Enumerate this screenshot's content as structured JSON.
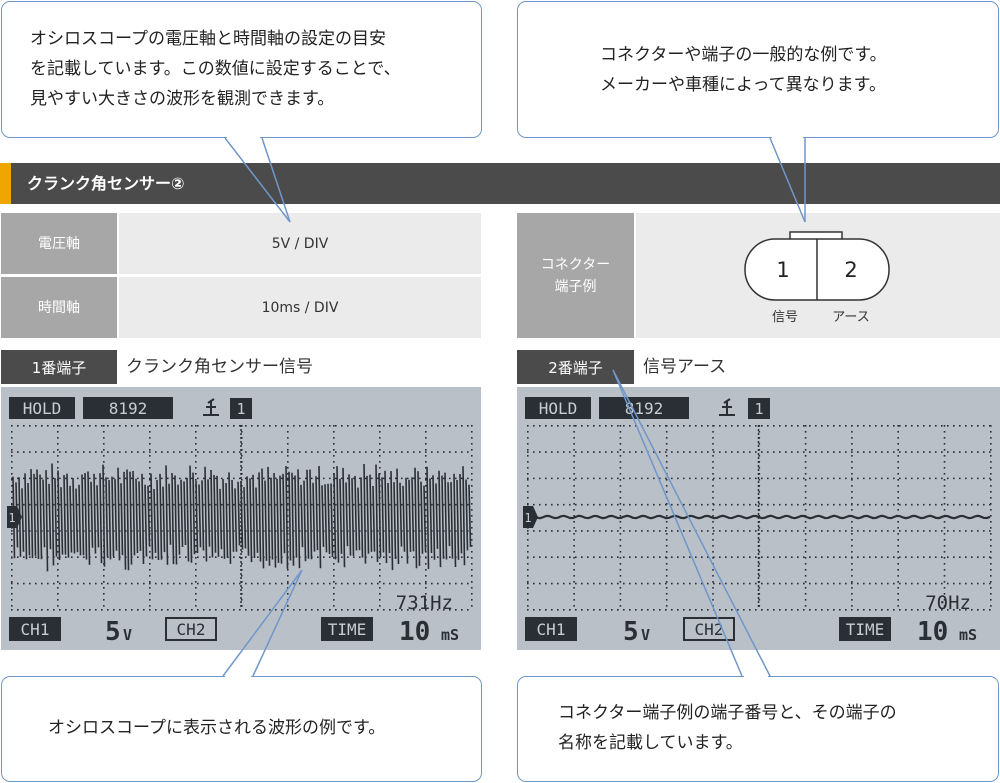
{
  "callouts": {
    "top_left": [
      "オシロスコープの電圧軸と時間軸の設定の目安",
      "を記載しています。この数値に設定することで、",
      "見やすい大きさの波形を観測できます。"
    ],
    "top_right": [
      "コネクターや端子の一般的な例です。",
      "メーカーや車種によって異なります。"
    ],
    "bottom_left": [
      "オシロスコープに表示される波形の例です。"
    ],
    "bottom_right": [
      "コネクター端子例の端子番号と、その端子の",
      "名称を記載しています。"
    ]
  },
  "section": {
    "title": "クランク角センサー②"
  },
  "settings": {
    "voltage_label": "電圧軸",
    "voltage_value": "5V / DIV",
    "time_label": "時間軸",
    "time_value": "10ms / DIV"
  },
  "connector": {
    "label_line1": "コネクター",
    "label_line2": "端子例",
    "pin1_number": "1",
    "pin2_number": "2",
    "pin1_name": "信号",
    "pin2_name": "アース"
  },
  "pins": [
    {
      "label": "1番端子",
      "desc": "クランク角センサー信号"
    },
    {
      "label": "2番端子",
      "desc": "信号アース"
    }
  ],
  "scopes": [
    {
      "hold": "HOLD",
      "samples": "8192",
      "trigger_ch": "1",
      "marker": "1",
      "freq": "731Hz",
      "ch1": "CH1",
      "volt_num": "5",
      "volt_unit": "V",
      "ch2": "CH2",
      "time": "TIME",
      "time_num": "10",
      "time_unit": "mS",
      "waveform": "noise"
    },
    {
      "hold": "HOLD",
      "samples": "8192",
      "trigger_ch": "1",
      "marker": "1",
      "freq": "70Hz",
      "ch1": "CH1",
      "volt_num": "5",
      "volt_unit": "V",
      "ch2": "CH2",
      "time": "TIME",
      "time_num": "10",
      "time_unit": "mS",
      "waveform": "flat"
    }
  ],
  "colors": {
    "accent": "#f0a600",
    "header": "#4b4b4b",
    "callout_border": "#6f97c9",
    "lcd_bg": "#b9c0c8",
    "lcd_ink": "#2a2f36"
  }
}
